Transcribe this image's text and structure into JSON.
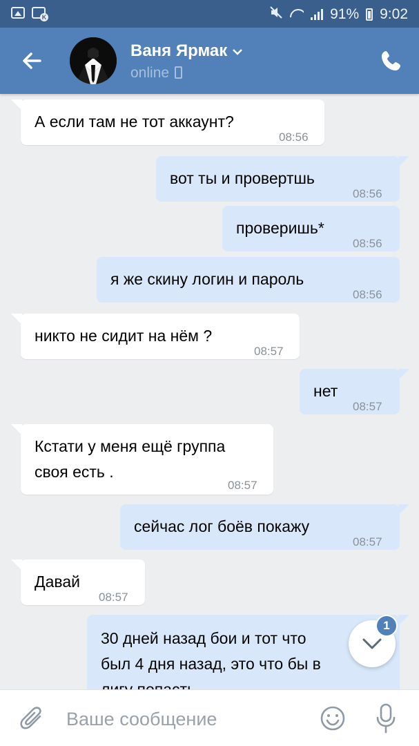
{
  "status_bar": {
    "battery": "91%",
    "time": "9:02",
    "icons": [
      "gallery-icon",
      "vk-notification-icon",
      "mute-icon",
      "wifi-icon",
      "signal-icon",
      "battery-icon"
    ]
  },
  "header": {
    "name": "Ваня Ярмак",
    "status": "online",
    "icons": [
      "back-arrow-icon",
      "chevron-down-icon",
      "mobile-icon",
      "phone-icon"
    ]
  },
  "messages": [
    {
      "dir": "in",
      "lines": [
        "А если там не тот аккаунт?"
      ],
      "time": "08:56"
    },
    {
      "dir": "out",
      "lines": [
        "вот ты и провертшь"
      ],
      "time": "08:56"
    },
    {
      "dir": "out",
      "lines": [
        "проверишь*"
      ],
      "time": "08:56"
    },
    {
      "dir": "out",
      "lines": [
        "я же скину логин и пароль"
      ],
      "time": "08:56"
    },
    {
      "dir": "in",
      "lines": [
        "никто не сидит на нём ?"
      ],
      "time": "08:57"
    },
    {
      "dir": "out",
      "lines": [
        "нет"
      ],
      "time": "08:57"
    },
    {
      "dir": "in",
      "lines": [
        "Кстати у меня ещё группа",
        "своя есть ."
      ],
      "time": "08:57"
    },
    {
      "dir": "out",
      "lines": [
        "сейчас лог боёв покажу"
      ],
      "time": "08:57"
    },
    {
      "dir": "in",
      "lines": [
        "Давай"
      ],
      "time": "08:57"
    },
    {
      "dir": "out",
      "lines": [
        "30 дней назад бои и тот что",
        "был 4 дня назад, это что бы в",
        "лигу попасть"
      ],
      "time": ""
    }
  ],
  "scroll_down": {
    "badge": "1"
  },
  "input": {
    "placeholder": "Ваше сообщение"
  },
  "colors": {
    "header": "#5181b8",
    "status_bar": "#3b5f8c",
    "incoming": "#ffffff",
    "outgoing": "#d8e7fa",
    "background": "#edeef0"
  }
}
